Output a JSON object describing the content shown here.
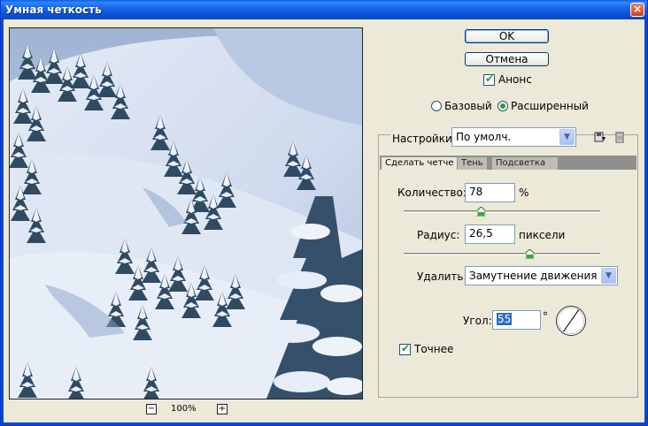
{
  "window": {
    "title": "Умная четкость",
    "close_glyph": "×"
  },
  "preview": {
    "zoom_level": "100%",
    "zoom_minus": "−",
    "zoom_plus": "+"
  },
  "buttons": {
    "ok": "OK",
    "cancel": "Отмена"
  },
  "preview_toggle": {
    "label": "Анонс",
    "checked": true
  },
  "mode": {
    "basic": "Базовый",
    "advanced": "Расширенный",
    "selected": "advanced"
  },
  "settings": {
    "label": "Настройки:",
    "value": "По умолч."
  },
  "tabs": [
    {
      "label": "Сделать четче",
      "active": true
    },
    {
      "label": "Тень",
      "active": false
    },
    {
      "label": "Подсветка",
      "active": false
    }
  ],
  "amount": {
    "label": "Количество:",
    "value": "78",
    "unit": "%",
    "max": 500
  },
  "radius": {
    "label": "Радиус:",
    "value": "26,5",
    "unit": "пиксели",
    "max": 64
  },
  "remove": {
    "label": "Удалить:",
    "value": "Замутнение движения"
  },
  "angle": {
    "label": "Угол:",
    "value": "55",
    "unit": "°"
  },
  "more_accurate": {
    "label": "Точнее",
    "checked": true
  },
  "icons": {
    "save": "save-settings-icon",
    "delete": "trash-icon"
  }
}
